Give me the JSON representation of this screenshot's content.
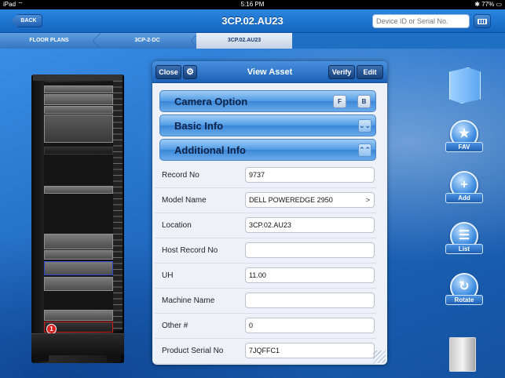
{
  "status_bar": {
    "device": "iPad",
    "wifi": "wifi-icon",
    "time": "5:16 PM",
    "battery": "77%",
    "bluetooth": "bluetooth-icon"
  },
  "nav": {
    "back_label": "BACK",
    "title": "3CP.02.AU23",
    "search_placeholder": "Device ID or Serial No."
  },
  "breadcrumb": {
    "items": [
      "FLOOR PLANS",
      "3CP-2-DC",
      "3CP.02.AU23"
    ]
  },
  "panel": {
    "title": "View Asset",
    "close_label": "Close",
    "verify_label": "Verify",
    "edit_label": "Edit",
    "sections": [
      {
        "label": "Camera Option"
      },
      {
        "label": "Basic  Info"
      },
      {
        "label": "Additional Info"
      }
    ],
    "camera_icons": [
      "F",
      "B"
    ],
    "fields": [
      {
        "label": "Record No",
        "value": "9737"
      },
      {
        "label": "Model Name",
        "value": "DELL POWEREDGE 2950",
        "arrow": ">"
      },
      {
        "label": "Location",
        "value": "3CP.02.AU23"
      },
      {
        "label": "Host Record No",
        "value": ""
      },
      {
        "label": "UH",
        "value": "11.00"
      },
      {
        "label": "Machine Name",
        "value": ""
      },
      {
        "label": "Other #",
        "value": "0"
      },
      {
        "label": "Product Serial No",
        "value": "7JQFFC1"
      }
    ]
  },
  "rack": {
    "alert_count": "1"
  },
  "dock": {
    "fav": "FAV",
    "add": "Add",
    "list": "List",
    "rotate": "Rotate"
  },
  "colors": {
    "nav_blue": "#1565bf",
    "panel_bg": "#eef2f8",
    "alert_red": "#d92323",
    "selected_blue": "#2f46c8"
  }
}
